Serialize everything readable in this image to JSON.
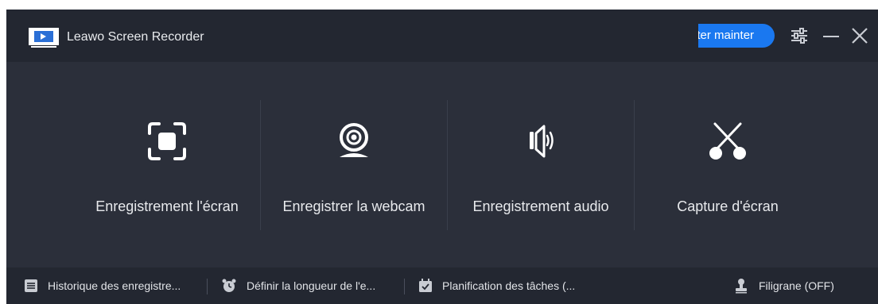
{
  "app": {
    "title": "Leawo Screen Recorder"
  },
  "header": {
    "buy_label": "eter mainter"
  },
  "modes": [
    {
      "label": "Enregistrement l'écran",
      "icon": "screen-record-icon"
    },
    {
      "label": "Enregistrer la webcam",
      "icon": "webcam-icon"
    },
    {
      "label": "Enregistrement audio",
      "icon": "speaker-icon"
    },
    {
      "label": "Capture d'écran",
      "icon": "scissors-icon"
    }
  ],
  "footer": {
    "history": "Historique des enregistre...",
    "duration": "Définir la longueur de l'e...",
    "schedule": "Planification des tâches (...",
    "watermark": "Filigrane (OFF)"
  },
  "colors": {
    "accent": "#1a78f0",
    "window_bg": "#2b2f3a",
    "bar_bg": "#232731",
    "text": "#e8eaed"
  }
}
